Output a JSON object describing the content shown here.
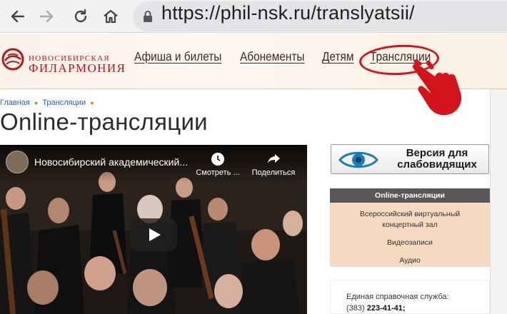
{
  "browser": {
    "url": "https://phil-nsk.ru/translyatsii/",
    "back_icon": "arrow-left-icon",
    "forward_icon": "arrow-right-icon",
    "reload_icon": "reload-icon",
    "home_icon": "home-icon",
    "lock_icon": "lock-icon"
  },
  "site": {
    "logo_line1": "НОВОСИБИРСКАЯ",
    "logo_line2": "ФИЛАРМОНИЯ",
    "menu": [
      {
        "label": "Афиша и билеты"
      },
      {
        "label": "Абонементы"
      },
      {
        "label": "Детям"
      },
      {
        "label": "Трансляции"
      }
    ],
    "accent_color": "#d4141c"
  },
  "breadcrumb": [
    "Главная",
    "Трансляции"
  ],
  "page_title": "Online-трансляции",
  "video": {
    "title": "Новосибирский академический...",
    "watch_later": "Смотреть ...",
    "share": "Поделиться"
  },
  "sidebar": {
    "accessible_version": "Версия для слабовидящих",
    "nav": [
      {
        "label": "Online-трансляции",
        "active": true
      },
      {
        "label": "Всероссийский виртуальный концертный зал",
        "active": false
      },
      {
        "label": "Видеозаписи",
        "active": false
      },
      {
        "label": "Аудио",
        "active": false
      }
    ],
    "info_label": "Единая справочная служба:",
    "phone_code": "(383)",
    "phone_number": "223-41-41;"
  }
}
